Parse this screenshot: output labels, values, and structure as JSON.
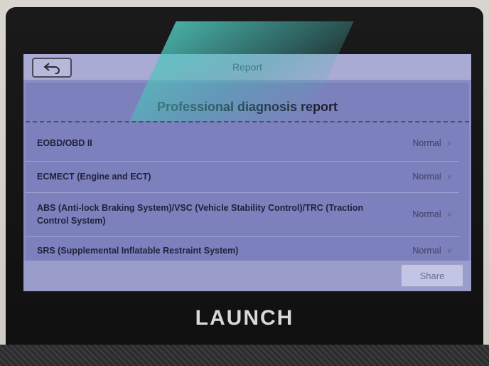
{
  "screen": {
    "title": "Report",
    "report_title": "Professional diagnosis report",
    "rows": [
      {
        "label": "EOBD/OBD II",
        "status": "Normal"
      },
      {
        "label": "ECMECT (Engine and ECT)",
        "status": "Normal"
      },
      {
        "label": "ABS (Anti-lock Braking System)/VSC (Vehicle Stability Control)/TRC (Traction Control System)",
        "status": "Normal"
      },
      {
        "label": "SRS (Supplemental Inflatable Restraint System)",
        "status": "Normal"
      }
    ],
    "share_label": "Share"
  },
  "device": {
    "brand": "LAUNCH"
  },
  "icons": {
    "back": "back-arrow-icon",
    "chevron": "chevron-down-icon"
  },
  "colors": {
    "screen_bg": "#8a8ec4",
    "titlebar_bg": "#a9abd4",
    "glare": "#50c8be"
  }
}
